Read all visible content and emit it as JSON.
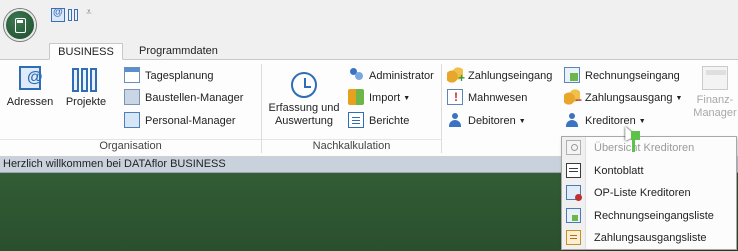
{
  "tabs": [
    {
      "label": "BUSINESS",
      "active": true
    },
    {
      "label": "Programmdaten",
      "active": false
    }
  ],
  "groups": {
    "organisation": {
      "label": "Organisation",
      "adressen": "Adressen",
      "projekte": "Projekte",
      "tagesplanung": "Tagesplanung",
      "baustellen_manager": "Baustellen-Manager",
      "personal_manager": "Personal-Manager"
    },
    "nachkalkulation": {
      "label": "Nachkalkulation",
      "erfassung_line1": "Erfassung und",
      "erfassung_line2": "Auswertung",
      "administrator": "Administrator",
      "import": "Import",
      "berichte": "Berichte"
    },
    "finanzen": {
      "zahlungseingang": "Zahlungseingang",
      "rechnungseingang": "Rechnungseingang",
      "mahnwesen": "Mahnwesen",
      "zahlungsausgang": "Zahlungsausgang",
      "debitoren": "Debitoren",
      "kreditoren": "Kreditoren",
      "finanz_manager_line1": "Finanz-",
      "finanz_manager_line2": "Manager"
    }
  },
  "status_message": "Herzlich willkommen bei DATAflor BUSINESS",
  "kreditoren_menu": [
    {
      "label": "Übersicht Kreditoren",
      "disabled": true,
      "icon": "search-list-icon"
    },
    {
      "label": "Kontoblatt",
      "disabled": false,
      "icon": "ledger-icon"
    },
    {
      "label": "OP-Liste Kreditoren",
      "disabled": false,
      "icon": "open-items-icon"
    },
    {
      "label": "Rechnungseingangsliste",
      "disabled": false,
      "icon": "invoice-list-icon"
    },
    {
      "label": "Zahlungsausgangsliste",
      "disabled": false,
      "icon": "payment-list-icon"
    }
  ],
  "colors": {
    "workspace": "#2d5530",
    "statusbar": "#c9d2dc",
    "accent": "#2f6db5"
  }
}
